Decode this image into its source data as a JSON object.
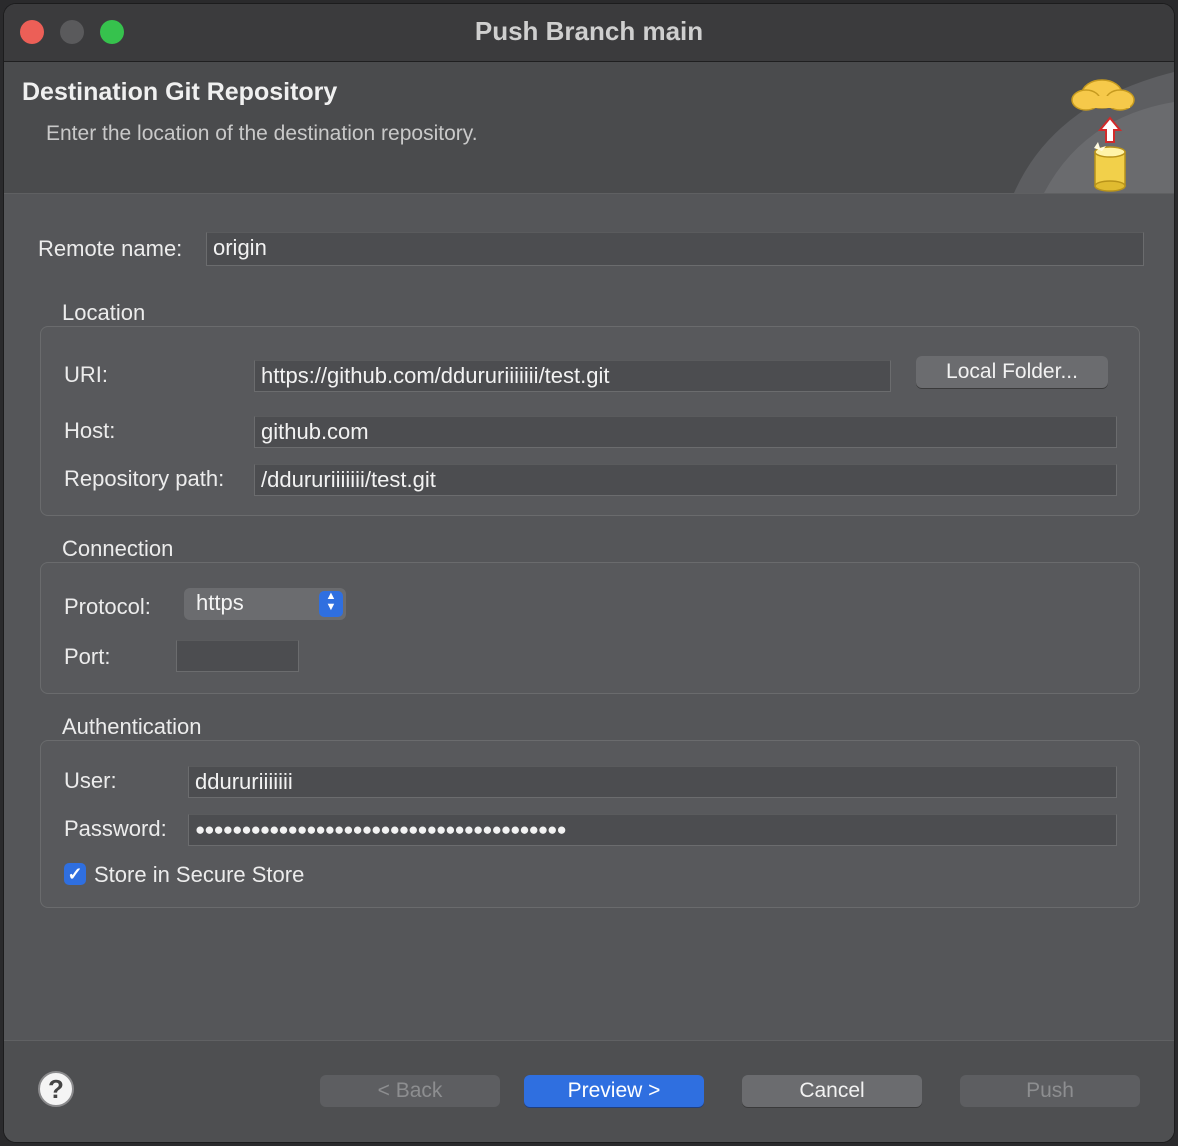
{
  "window": {
    "title": "Push Branch main"
  },
  "banner": {
    "title": "Destination Git Repository",
    "description": "Enter the location of the destination repository."
  },
  "remote": {
    "label": "Remote name:",
    "value": "origin"
  },
  "location": {
    "group_label": "Location",
    "uri_label": "URI:",
    "uri_value": "https://github.com/ddururiiiiiii/test.git",
    "local_folder_button": "Local Folder...",
    "host_label": "Host:",
    "host_value": "github.com",
    "path_label": "Repository path:",
    "path_value": "/ddururiiiiiii/test.git"
  },
  "connection": {
    "group_label": "Connection",
    "protocol_label": "Protocol:",
    "protocol_value": "https",
    "port_label": "Port:",
    "port_value": ""
  },
  "authentication": {
    "group_label": "Authentication",
    "user_label": "User:",
    "user_value": "ddururiiiiiii",
    "password_label": "Password:",
    "password_value": "●●●●●●●●●●●●●●●●●●●●●●●●●●●●●●●●●●●●●●●●",
    "store_label": "Store in Secure Store",
    "store_checked": true
  },
  "footer": {
    "help_icon": "?",
    "back_button": "< Back",
    "preview_button": "Preview >",
    "cancel_button": "Cancel",
    "push_button": "Push"
  }
}
